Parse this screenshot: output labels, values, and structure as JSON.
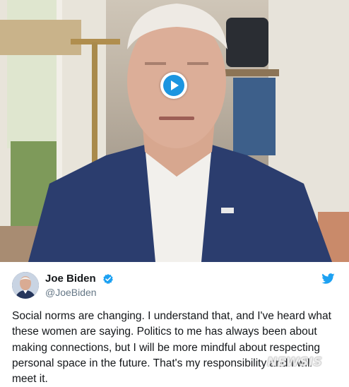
{
  "video": {
    "play_icon": "play-icon",
    "play_color": "#1b95e0"
  },
  "tweet": {
    "display_name": "Joe Biden",
    "handle": "@JoeBiden",
    "verified_icon": "verified-badge-icon",
    "brand_icon": "twitter-bird-icon",
    "brand_color": "#1da1f2",
    "text": "Social norms are changing. I understand that, and I've heard what these women are saying. Politics to me has always been about making connections, but I will be more mindful about respecting personal space in the future. That's my responsibility and I will meet it."
  },
  "watermark": "NEWSIS"
}
